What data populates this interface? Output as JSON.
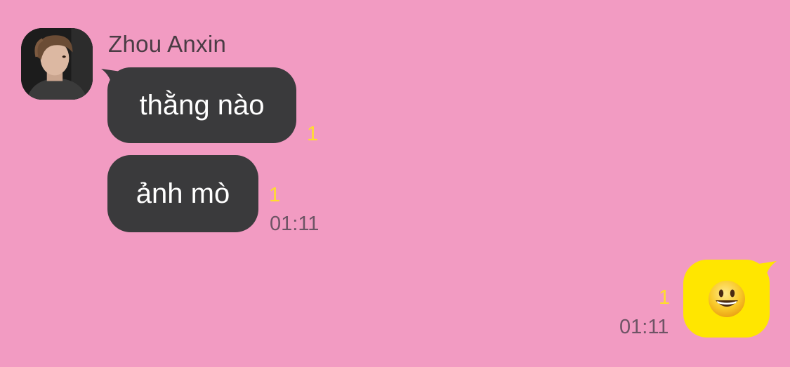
{
  "contact": {
    "name": "Zhou Anxin"
  },
  "messages": [
    {
      "direction": "incoming",
      "text": "thằng nào",
      "unread_count": "1"
    },
    {
      "direction": "incoming",
      "text": "ảnh mò",
      "unread_count": "1",
      "time": "01:11"
    },
    {
      "direction": "outgoing",
      "emoji": "smiling-face-with-open-mouth",
      "unread_count": "1",
      "time": "01:11"
    }
  ],
  "colors": {
    "background": "#f29bc2",
    "incoming_bubble": "#3a3a3c",
    "outgoing_bubble": "#ffe600",
    "unread_count": "#ffde2b",
    "timestamp": "#6e5465"
  }
}
